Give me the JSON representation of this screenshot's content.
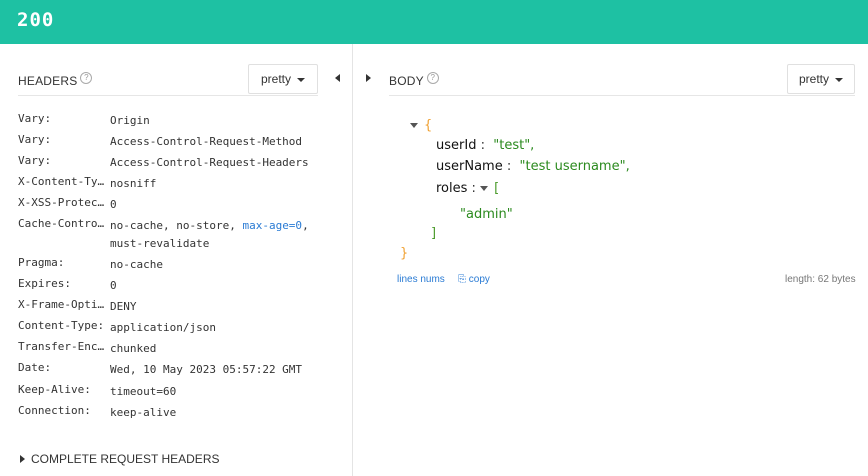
{
  "status": {
    "code": "200"
  },
  "headers_panel": {
    "title": "HEADERS",
    "help": "?",
    "format_select": "pretty",
    "rows": [
      {
        "key": "Vary:",
        "value": "Origin"
      },
      {
        "key": "Vary:",
        "value": "Access-Control-Request-Method"
      },
      {
        "key": "Vary:",
        "value": "Access-Control-Request-Headers"
      },
      {
        "key": "X-Content-Ty…",
        "value": "nosniff"
      },
      {
        "key": "X-XSS-Protec…",
        "value": "0"
      },
      {
        "key": "Cache-Contro…",
        "value_part1": "no-cache, no-store, ",
        "value_link": "max-age=0",
        "value_part2": ",",
        "value_line2": "must-revalidate"
      },
      {
        "key": "Pragma:",
        "value": "no-cache"
      },
      {
        "key": "Expires:",
        "value": "0"
      },
      {
        "key": "X-Frame-Opti…",
        "value": "DENY"
      },
      {
        "key": "Content-Type:",
        "value": "application/json"
      },
      {
        "key": "Transfer-Enc…",
        "value": "chunked"
      },
      {
        "key": "Date:",
        "value": "Wed, 10 May 2023 05:57:22 GMT"
      },
      {
        "key": "Keep-Alive:",
        "value": "timeout=60"
      },
      {
        "key": "Connection:",
        "value": "keep-alive"
      }
    ],
    "complete_request_headers": "COMPLETE REQUEST HEADERS"
  },
  "body_panel": {
    "title": "BODY",
    "help": "?",
    "format_select": "pretty",
    "json": {
      "open_brace": "{",
      "close_brace": "}",
      "userId_key": "userId",
      "userId_val": "\"test\",",
      "userName_key": "userName",
      "userName_val": "\"test username\",",
      "roles_key": "roles",
      "open_bracket": "[",
      "close_bracket": "]",
      "role_0": "\"admin\"",
      "colon": ":"
    },
    "lines_nums": "lines nums",
    "copy": "copy",
    "length": "length: 62 bytes"
  }
}
